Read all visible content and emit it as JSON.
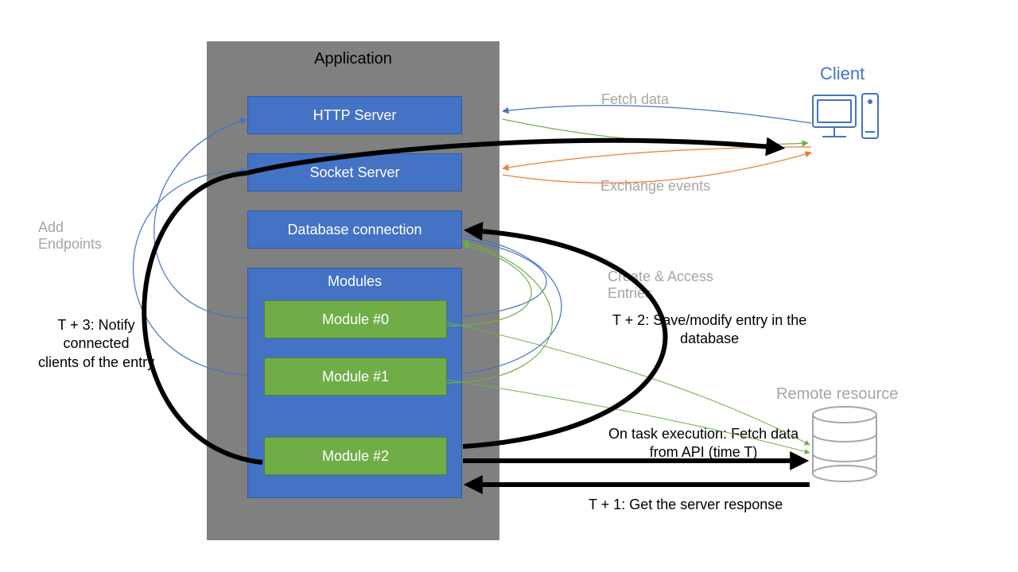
{
  "app": {
    "title": "Application",
    "boxes": {
      "http": "HTTP Server",
      "socket": "Socket Server",
      "db": "Database connection",
      "modulesTitle": "Modules",
      "module0": "Module #0",
      "module1": "Module #1",
      "module2": "Module #2"
    }
  },
  "external": {
    "client": "Client",
    "remote": "Remote resource"
  },
  "labels": {
    "fetchData": "Fetch data",
    "exchangeEvents": "Exchange events",
    "addEndpoints": "Add\nEndpoints",
    "createAccess": "Create & Access\nEntries",
    "t3": "T + 3: Notify\nconnected\nclients of the entry",
    "t2": "T + 2: Save/modify entry in the\ndatabase",
    "onTask": "On task execution: Fetch data\nfrom API (time T)",
    "t1": "T + 1: Get the server response"
  }
}
